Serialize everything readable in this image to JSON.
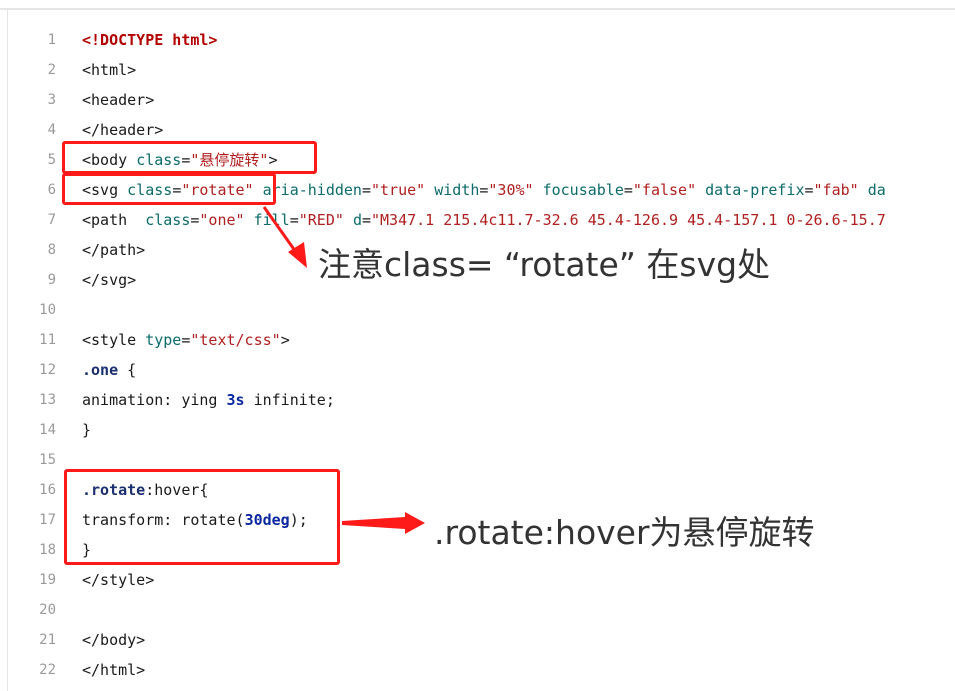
{
  "code_lines": [
    {
      "n": "1",
      "segments": [
        [
          "kw",
          "<!DOCTYPE html>"
        ]
      ]
    },
    {
      "n": "2",
      "segments": [
        [
          "tag",
          "<html>"
        ]
      ]
    },
    {
      "n": "3",
      "segments": [
        [
          "tag",
          "<header>"
        ]
      ]
    },
    {
      "n": "4",
      "segments": [
        [
          "tag",
          "</header>"
        ]
      ]
    },
    {
      "n": "5",
      "segments": [
        [
          "tag",
          "<body "
        ],
        [
          "attr",
          "class"
        ],
        [
          "tag",
          "="
        ],
        [
          "str",
          "\"悬停旋转\""
        ],
        [
          "tag",
          ">"
        ]
      ]
    },
    {
      "n": "6",
      "segments": [
        [
          "tag",
          "<svg "
        ],
        [
          "attr",
          "class"
        ],
        [
          "tag",
          "="
        ],
        [
          "str",
          "\"rotate\""
        ],
        [
          "tag",
          " "
        ],
        [
          "attr",
          "aria-hidden"
        ],
        [
          "tag",
          "="
        ],
        [
          "str",
          "\"true\""
        ],
        [
          "tag",
          " "
        ],
        [
          "attr",
          "width"
        ],
        [
          "tag",
          "="
        ],
        [
          "str",
          "\"30%\""
        ],
        [
          "tag",
          " "
        ],
        [
          "attr",
          "focusable"
        ],
        [
          "tag",
          "="
        ],
        [
          "str",
          "\"false\""
        ],
        [
          "tag",
          " "
        ],
        [
          "attr",
          "data-prefix"
        ],
        [
          "tag",
          "="
        ],
        [
          "str",
          "\"fab\""
        ],
        [
          "tag",
          " "
        ],
        [
          "attr",
          "da"
        ]
      ]
    },
    {
      "n": "7",
      "segments": [
        [
          "tag",
          "<path  "
        ],
        [
          "attr",
          "class"
        ],
        [
          "tag",
          "="
        ],
        [
          "str",
          "\"one\""
        ],
        [
          "tag",
          " "
        ],
        [
          "attr",
          "fill"
        ],
        [
          "tag",
          "="
        ],
        [
          "str",
          "\"RED\""
        ],
        [
          "tag",
          " "
        ],
        [
          "attr",
          "d"
        ],
        [
          "tag",
          "="
        ],
        [
          "str",
          "\"M347.1 215.4c11.7-32.6 45.4-126.9 45.4-157.1 0-26.6-15.7"
        ]
      ]
    },
    {
      "n": "8",
      "segments": [
        [
          "tag",
          "</path>"
        ]
      ]
    },
    {
      "n": "9",
      "segments": [
        [
          "tag",
          "</svg>"
        ]
      ]
    },
    {
      "n": "10",
      "segments": []
    },
    {
      "n": "11",
      "segments": [
        [
          "tag",
          "<style "
        ],
        [
          "attr",
          "type"
        ],
        [
          "tag",
          "="
        ],
        [
          "str",
          "\"text/css\""
        ],
        [
          "tag",
          ">"
        ]
      ]
    },
    {
      "n": "12",
      "segments": [
        [
          "sel",
          ".one"
        ],
        [
          "tag",
          " {"
        ]
      ]
    },
    {
      "n": "13",
      "segments": [
        [
          "tag",
          "animation: ying "
        ],
        [
          "num",
          "3s"
        ],
        [
          "tag",
          " infinite;"
        ]
      ]
    },
    {
      "n": "14",
      "segments": [
        [
          "tag",
          "}"
        ]
      ]
    },
    {
      "n": "15",
      "segments": []
    },
    {
      "n": "16",
      "segments": [
        [
          "sel",
          ".rotate"
        ],
        [
          "tag",
          ":hover{"
        ]
      ]
    },
    {
      "n": "17",
      "segments": [
        [
          "tag",
          "transform: rotate("
        ],
        [
          "num",
          "30deg"
        ],
        [
          "tag",
          ");"
        ]
      ]
    },
    {
      "n": "18",
      "segments": [
        [
          "tag",
          "}"
        ]
      ]
    },
    {
      "n": "19",
      "segments": [
        [
          "tag",
          "</style>"
        ]
      ]
    },
    {
      "n": "20",
      "segments": []
    },
    {
      "n": "21",
      "segments": [
        [
          "tag",
          "</body>"
        ]
      ]
    },
    {
      "n": "22",
      "segments": [
        [
          "tag",
          "</html>"
        ]
      ]
    }
  ],
  "annotations": {
    "note_class_rotate": "注意class= “rotate” 在svg处",
    "note_hover": ".rotate:hover为悬停旋转"
  },
  "colors": {
    "highlight_box": "#ff1a1a",
    "line_number": "#9a9a9a"
  }
}
